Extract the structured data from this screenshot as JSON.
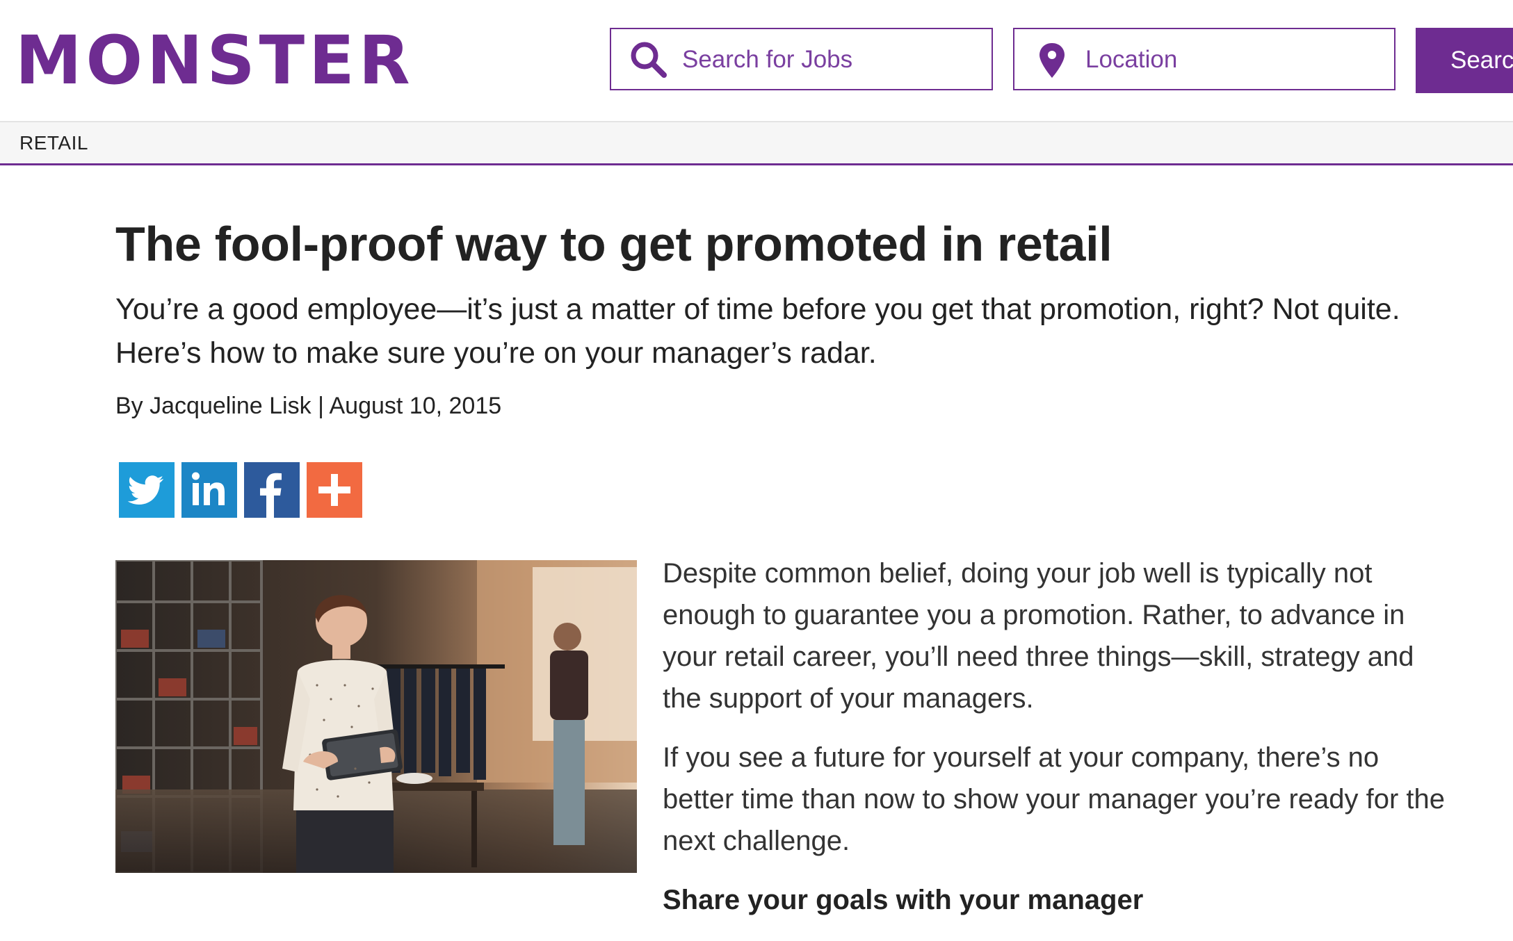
{
  "brand": {
    "logo_text": "MONSTER",
    "accent_color": "#6e2c91"
  },
  "search": {
    "jobs_placeholder": "Search for Jobs",
    "jobs_icon": "search-icon",
    "location_placeholder": "Location",
    "location_icon": "map-pin-icon",
    "button_label": "Search"
  },
  "nav": {
    "category_label": "RETAIL"
  },
  "article": {
    "title": "The fool-proof way to get promoted in retail",
    "subtitle": "You’re a good employee—it’s just a matter of time before you get that promotion, right? Not quite. Here’s how to make sure you’re on your manager’s radar.",
    "byline": {
      "prefix": "By",
      "author": "Jacqueline Lisk",
      "separator": "|",
      "date": "August 10, 2015"
    },
    "share": [
      {
        "network": "twitter",
        "icon": "twitter-icon",
        "color": "#1e9cd9"
      },
      {
        "network": "linkedin",
        "icon": "linkedin-icon",
        "color": "#1c86c6"
      },
      {
        "network": "facebook",
        "icon": "facebook-icon",
        "color": "#2d5a9c"
      },
      {
        "network": "more",
        "icon": "plus-icon",
        "color": "#f26a41"
      }
    ],
    "hero_image": "retail-store-worker-with-tablet-photo",
    "paragraphs": [
      "Despite common belief, doing your job well is typically not enough to guarantee you a promotion. Rather, to advance in your retail career, you’ll need three things—skill, strategy and the support of your managers.",
      "If you see a future for yourself at your company, there’s no better time than now to show your manager you’re ready for the next challenge."
    ],
    "section_heading": "Share your goals with your manager"
  }
}
